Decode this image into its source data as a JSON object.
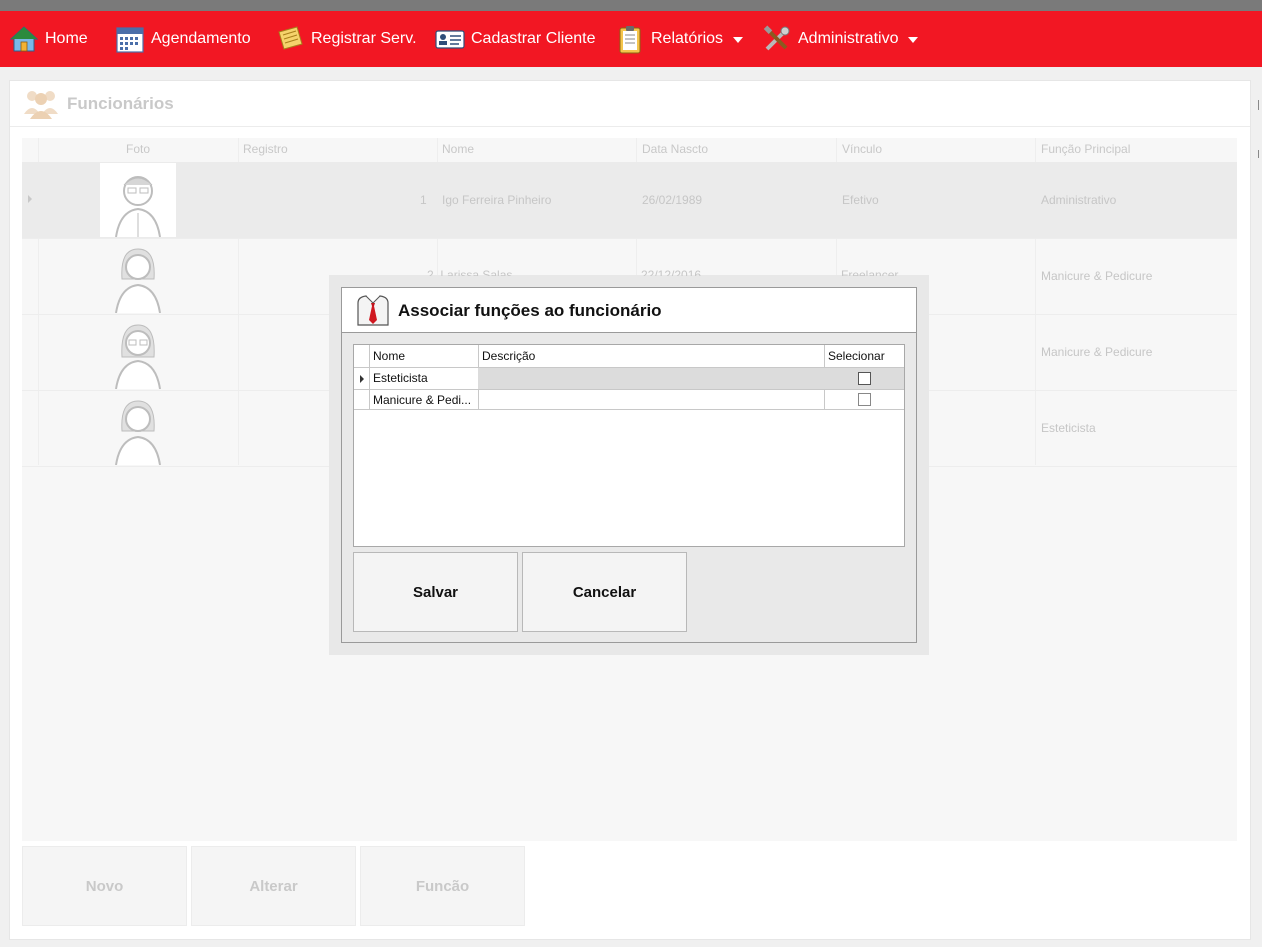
{
  "menu": {
    "home": "Home",
    "agendamento": "Agendamento",
    "registrar": "Registrar Serv.",
    "cadastrar": "Cadastrar Cliente",
    "relatorios": "Relatórios",
    "administrativo": "Administrativo"
  },
  "page": {
    "title": "Funcionários"
  },
  "grid": {
    "columns": [
      "Foto",
      "Registro",
      "Nome",
      "Data Nascto",
      "Vínculo",
      "Função Principal"
    ],
    "rows": [
      {
        "registro": "1",
        "nome": "Igo Ferreira Pinheiro",
        "data": "26/02/1989",
        "vinculo": "Efetivo",
        "funcao": "Administrativo"
      },
      {
        "registro": "2",
        "nome": "Larissa Salas",
        "data": "22/12/2016",
        "vinculo": "Freelancer",
        "funcao": "Manicure & Pedicure"
      },
      {
        "registro": "",
        "nome": "",
        "data": "",
        "vinculo": "",
        "funcao": "Manicure & Pedicure"
      },
      {
        "registro": "",
        "nome": "",
        "data": "",
        "vinculo": "",
        "funcao": "Esteticista"
      }
    ]
  },
  "buttons": {
    "novo": "Novo",
    "alterar": "Alterar",
    "funcao": "Funcão"
  },
  "dialog": {
    "title": "Associar funções ao funcionário",
    "columns": {
      "nome": "Nome",
      "descricao": "Descrição",
      "selecionar": "Selecionar"
    },
    "rows": [
      {
        "nome": "Esteticista",
        "descricao": "",
        "selected": false
      },
      {
        "nome": "Manicure & Pedi...",
        "descricao": "",
        "selected": false
      }
    ],
    "salvar": "Salvar",
    "cancelar": "Cancelar"
  },
  "colors": {
    "menubar": "#f21723",
    "accent": "#c0141c"
  }
}
